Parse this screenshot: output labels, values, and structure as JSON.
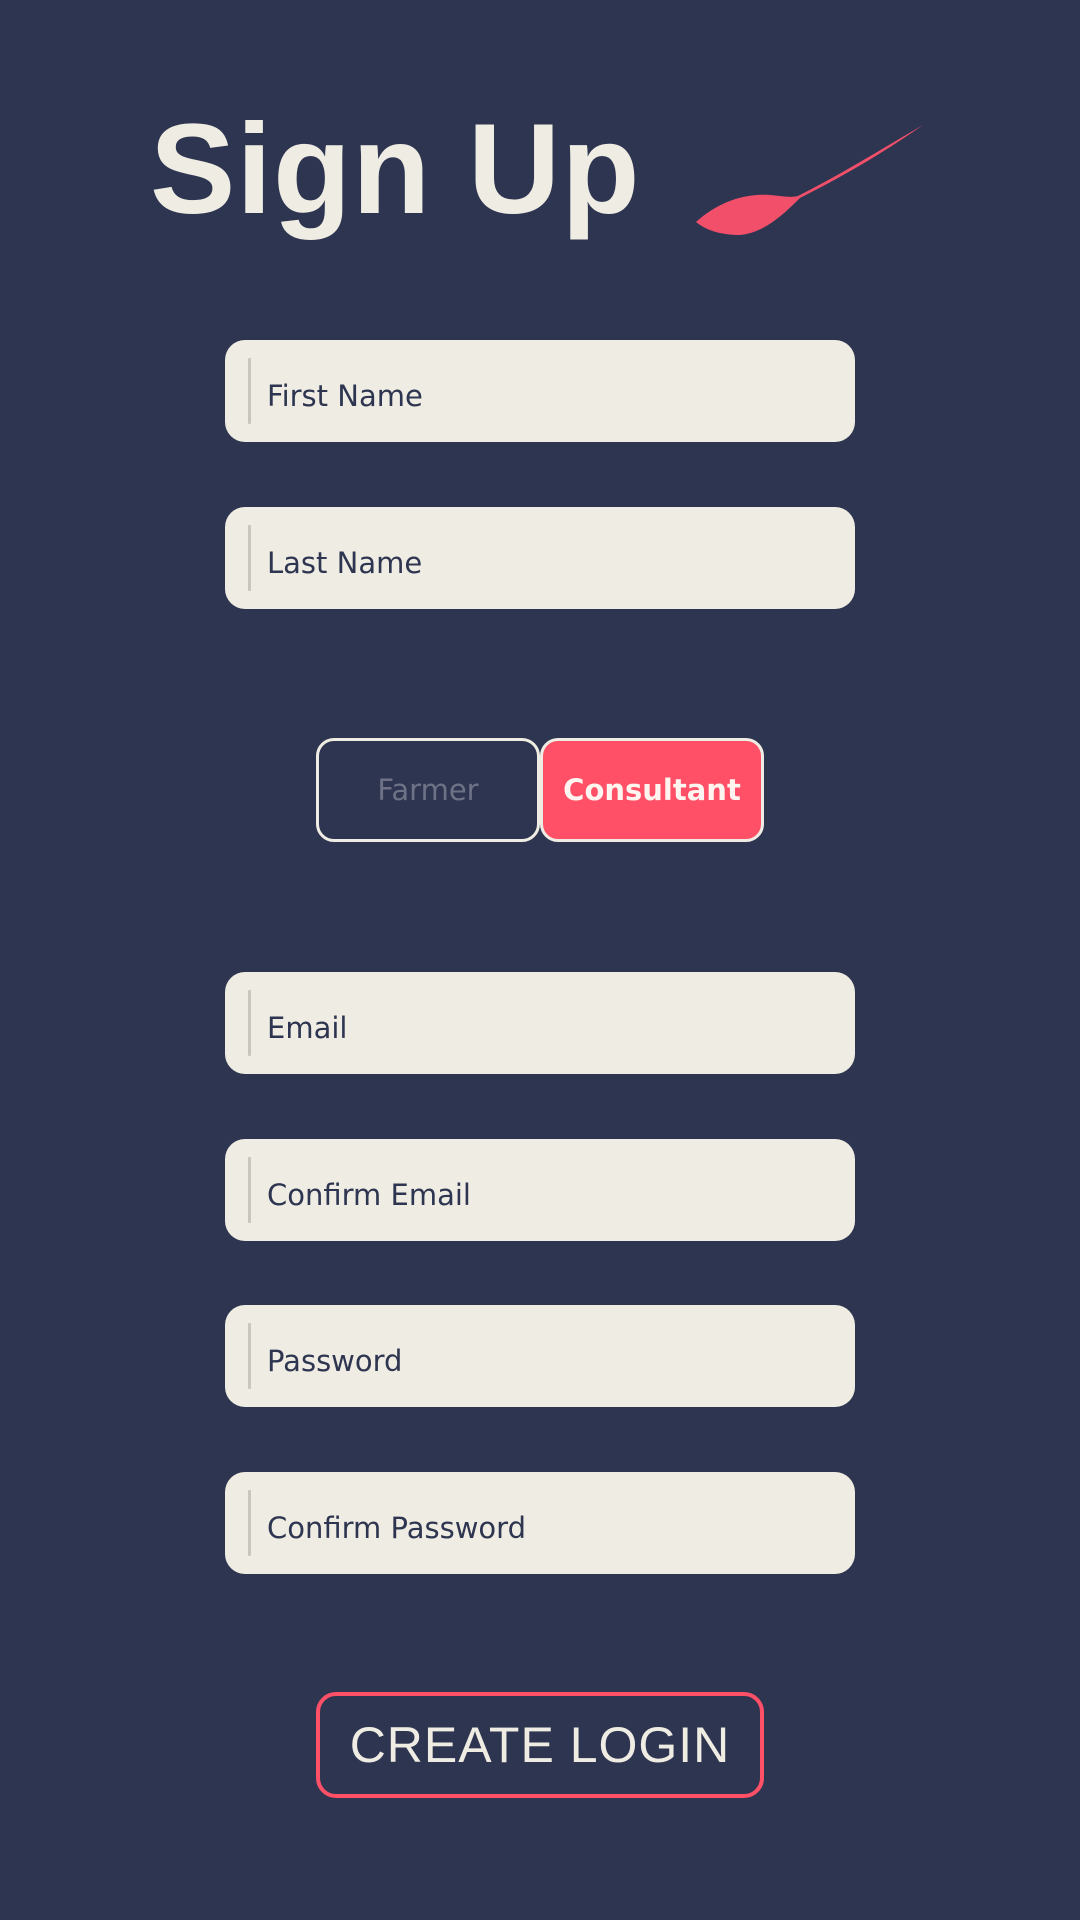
{
  "header": {
    "title": "Sign Up",
    "logo_icon": "leaf-icon"
  },
  "fields": {
    "first_name": {
      "placeholder": "First Name",
      "value": ""
    },
    "last_name": {
      "placeholder": "Last Name",
      "value": ""
    },
    "email": {
      "placeholder": "Email",
      "value": ""
    },
    "confirm_email": {
      "placeholder": "Confirm Email",
      "value": ""
    },
    "password": {
      "placeholder": "Password",
      "value": ""
    },
    "confirm_password": {
      "placeholder": "Confirm Password",
      "value": ""
    }
  },
  "role_toggle": {
    "options": [
      "Farmer",
      "Consultant"
    ],
    "selected": "Consultant"
  },
  "submit": {
    "label": "CREATE LOGIN"
  },
  "colors": {
    "background": "#2e3550",
    "field_background": "#efece3",
    "accent": "#ff5068",
    "text_light": "#efece3"
  }
}
